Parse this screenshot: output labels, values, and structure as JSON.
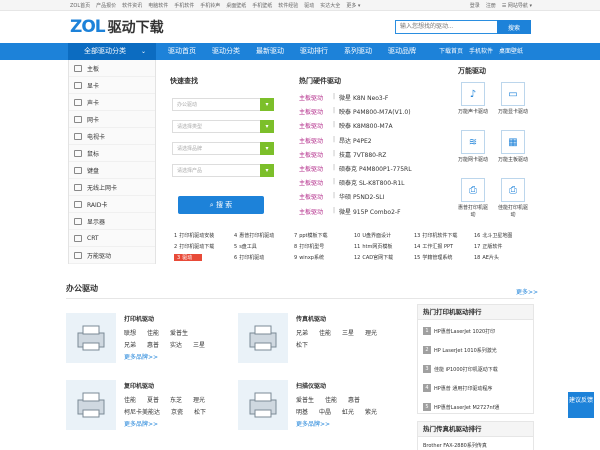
{
  "topbar": {
    "left": [
      "ZOL首页",
      "产品报价",
      "软件资讯",
      "电脑软件",
      "手机软件",
      "手机铃声",
      "桌面壁纸",
      "手机壁纸",
      "软件经验",
      "驱动",
      "实达大全",
      "更多 ▾"
    ],
    "right": [
      "登录",
      "注册",
      "☰ 网站导航 ▾"
    ]
  },
  "header": {
    "brand_zol": "ZOL",
    "brand_text": "驱动下载",
    "search_placeholder": "输入您想找的驱动...",
    "search_btn": "搜索"
  },
  "nav": {
    "cat": "全部驱动分类",
    "items": [
      "驱动首页",
      "驱动分类",
      "最新驱动",
      "驱动排行",
      "系列驱动",
      "驱动品牌"
    ],
    "items2": [
      "下载首页",
      "手机软件",
      "桌面壁纸"
    ]
  },
  "sidebar": [
    "主板",
    "显卡",
    "声卡",
    "网卡",
    "电视卡",
    "鼠标",
    "键盘",
    "无线上网卡",
    "RAID卡",
    "显示器",
    "CRT",
    "万能驱动"
  ],
  "quick": {
    "title": "快速查找",
    "selects": [
      "办公驱动",
      "请选择类型",
      "请选择品牌",
      "请选择产品"
    ],
    "button": "搜 索"
  },
  "hot": {
    "title": "热门硬件驱动",
    "rows": [
      [
        "主板驱动",
        "微星 K8N Neo3-F"
      ],
      [
        "主板驱动",
        "映泰 P4M800-M7A(V1.0)"
      ],
      [
        "主板驱动",
        "映泰 K8M800-M7A"
      ],
      [
        "主板驱动",
        "昂达 P4PE2"
      ],
      [
        "主板驱动",
        "技嘉 7VT880-RZ"
      ],
      [
        "主板驱动",
        "硕泰克 P4M800P1-775RL"
      ],
      [
        "主板驱动",
        "硕泰克 SL-K8T800-R1L"
      ],
      [
        "主板驱动",
        "华硕 P5ND2-SLI"
      ],
      [
        "主板驱动",
        "微星 915P Combo2-F"
      ]
    ]
  },
  "wanneng": {
    "title": "万能驱动",
    "items": [
      "万能声卡驱动",
      "万能显卡驱动",
      "万能网卡驱动",
      "万能主板驱动",
      "惠普打印机驱动",
      "佳能打印机驱动"
    ]
  },
  "links": [
    [
      "1",
      "打印机驱动安装"
    ],
    [
      "4",
      "惠普打印机驱动"
    ],
    [
      "7",
      "ppt模板下载"
    ],
    [
      "10",
      "U盘界面设计"
    ],
    [
      "13",
      "打印机软件下载"
    ],
    [
      "16",
      "北斗卫星地图"
    ],
    [
      "2",
      "打印机驱动下载"
    ],
    [
      "5",
      "s盘工具"
    ],
    [
      "8",
      "打印机型号"
    ],
    [
      "11",
      "htm网页模板"
    ],
    [
      "14",
      "工作汇报 PPT"
    ],
    [
      "17",
      "正版软件"
    ],
    [
      "3",
      "驱动"
    ],
    [
      "6",
      "打印机驱动"
    ],
    [
      "9",
      "winxp系统"
    ],
    [
      "12",
      "CAD官网下载"
    ],
    [
      "15",
      "学籍管理系统"
    ],
    [
      "18",
      "AE片头"
    ]
  ],
  "office": {
    "title": "办公驱动",
    "more": "更多>>"
  },
  "cards": [
    {
      "title": "打印机驱动",
      "brands": [
        [
          "联想",
          "佳能",
          "爱普生"
        ],
        [
          "兄弟",
          "惠普",
          "实达",
          "三星"
        ]
      ],
      "more": "更多品牌>>"
    },
    {
      "title": "传真机驱动",
      "brands": [
        [
          "兄弟",
          "佳能",
          "三星",
          "理光"
        ],
        [
          "松下"
        ]
      ],
      "more": ""
    },
    {
      "title": "复印机驱动",
      "brands": [
        [
          "佳能",
          "夏普",
          "东芝",
          "理光"
        ],
        [
          "柯尼卡美能达",
          "京瓷",
          "松下"
        ]
      ],
      "more": "更多品牌>>"
    },
    {
      "title": "扫描仪驱动",
      "brands": [
        [
          "爱普生",
          "佳能",
          "惠普"
        ],
        [
          "明基",
          "中晶",
          "虹光",
          "紫光"
        ]
      ],
      "more": "更多品牌>>"
    }
  ],
  "rank": {
    "title": "热门打印机驱动排行",
    "items": [
      "HP惠普LaserJet 1020打印",
      "HP LaserJet 1010系列激光",
      "佳能 iP1000打印机驱动下载",
      "HP惠普 通用打印驱动程序",
      "HP惠普LaserJet M2727nf通"
    ]
  },
  "rank2": {
    "title": "热门传真机驱动排行",
    "first": "Brother FAX-2880系列传真"
  },
  "suggest": "建议反馈"
}
